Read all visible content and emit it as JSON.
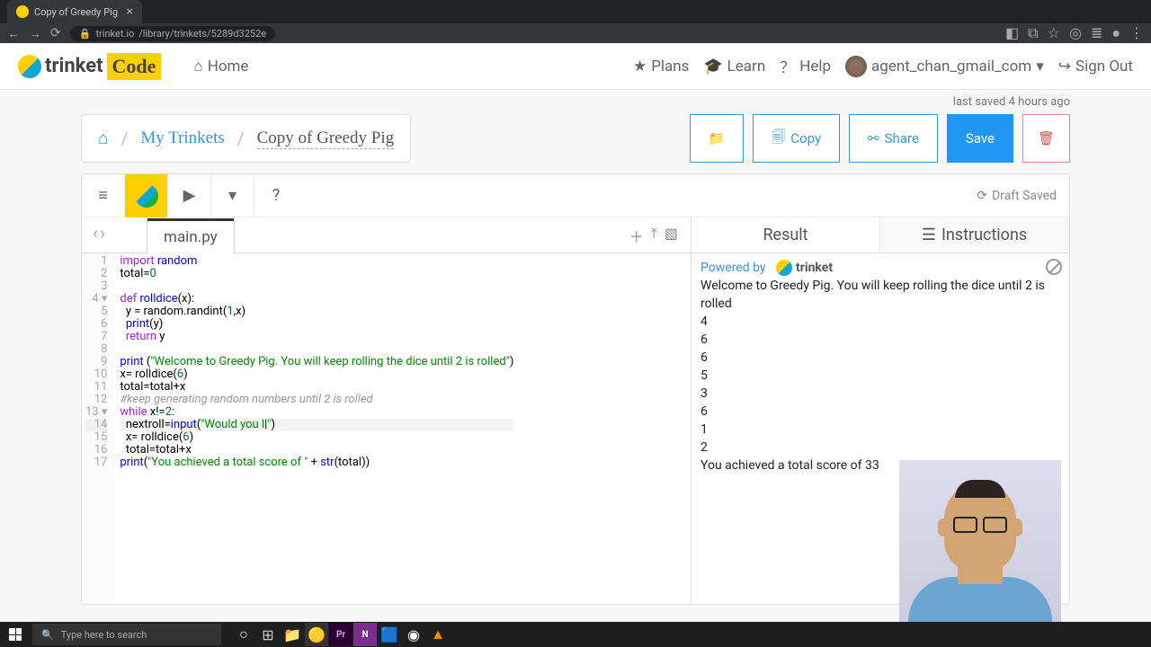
{
  "browser": {
    "tab_title": "Copy of Greedy Pig",
    "url_host": "trinket.io",
    "url_path": "/library/trinkets/5289d3252e"
  },
  "nav": {
    "brand": "trinket",
    "brand_code": "Code",
    "home": "Home",
    "plans": "Plans",
    "learn": "Learn",
    "help": "Help",
    "user": "agent_chan_gmail_com",
    "signout": "Sign Out"
  },
  "status": {
    "saved": "last saved 4 hours ago"
  },
  "breadcrumb": {
    "home_icon": "home",
    "my_trinkets": "My Trinkets",
    "current": "Copy of Greedy Pig"
  },
  "buttons": {
    "copy": "Copy",
    "share": "Share",
    "save": "Save"
  },
  "ide": {
    "draft_saved": "Draft Saved",
    "filename": "main.py",
    "help_icon": "?"
  },
  "code": {
    "lines": [
      {
        "n": 1,
        "text": "import random",
        "tokens": [
          [
            "kw",
            "import"
          ],
          [
            "",
            " "
          ],
          [
            "fn",
            "random"
          ]
        ]
      },
      {
        "n": 2,
        "text": "total=0",
        "tokens": [
          [
            "",
            "total="
          ],
          [
            "num",
            "0"
          ]
        ]
      },
      {
        "n": 3,
        "text": "",
        "tokens": [
          [
            "",
            ""
          ]
        ]
      },
      {
        "n": 4,
        "fold": true,
        "text": "def rolldice(x):",
        "tokens": [
          [
            "kw",
            "def"
          ],
          [
            "",
            " "
          ],
          [
            "fn",
            "rolldice"
          ],
          [
            "",
            "(x):"
          ]
        ]
      },
      {
        "n": 5,
        "text": "  y = random.randint(1,x)",
        "tokens": [
          [
            "",
            "  y = random.randint("
          ],
          [
            "num",
            "1"
          ],
          [
            "",
            ",x)"
          ]
        ]
      },
      {
        "n": 6,
        "text": "  print(y)",
        "tokens": [
          [
            "",
            "  "
          ],
          [
            "fn",
            "print"
          ],
          [
            "",
            "(y)"
          ]
        ]
      },
      {
        "n": 7,
        "text": "  return y",
        "tokens": [
          [
            "",
            "  "
          ],
          [
            "kw",
            "return"
          ],
          [
            "",
            " y"
          ]
        ]
      },
      {
        "n": 8,
        "text": "",
        "tokens": [
          [
            "",
            ""
          ]
        ]
      },
      {
        "n": 9,
        "text": "print (\"Welcome to Greedy Pig. You will keep rolling the dice until 2 is rolled\")",
        "tokens": [
          [
            "fn",
            "print"
          ],
          [
            "",
            " ("
          ],
          [
            "str",
            "\"Welcome to Greedy Pig. You will keep rolling the dice until 2 is rolled\""
          ],
          [
            "",
            ")"
          ]
        ]
      },
      {
        "n": 10,
        "text": "x= rolldice(6)",
        "tokens": [
          [
            "",
            "x= rolldice("
          ],
          [
            "num",
            "6"
          ],
          [
            "",
            ")"
          ]
        ]
      },
      {
        "n": 11,
        "text": "total=total+x",
        "tokens": [
          [
            "",
            "total=total+x"
          ]
        ]
      },
      {
        "n": 12,
        "text": "#keep generating random numbers until 2 is rolled",
        "tokens": [
          [
            "cm",
            "#keep generating random numbers until 2 is rolled"
          ]
        ]
      },
      {
        "n": 13,
        "fold": true,
        "text": "while x!=2:",
        "tokens": [
          [
            "kw",
            "while"
          ],
          [
            "",
            " x!="
          ],
          [
            "num",
            "2"
          ],
          [
            "",
            ":"
          ]
        ]
      },
      {
        "n": 14,
        "hl": true,
        "text": "  nextroll=input(\"Would you l|\")",
        "tokens": [
          [
            "",
            "  nextroll="
          ],
          [
            "fn",
            "input"
          ],
          [
            "",
            "("
          ],
          [
            "str",
            "\"Would you l"
          ],
          [
            "",
            "|"
          ],
          [
            "str",
            "\""
          ],
          [
            "",
            ")"
          ]
        ]
      },
      {
        "n": 15,
        "text": "  x= rolldice(6)",
        "tokens": [
          [
            "",
            "  x= rolldice("
          ],
          [
            "num",
            "6"
          ],
          [
            "",
            ")"
          ]
        ]
      },
      {
        "n": 16,
        "text": "  total=total+x",
        "tokens": [
          [
            "",
            "  total=total+x"
          ]
        ]
      },
      {
        "n": 17,
        "text": "print(\"You achieved a total score of \" + str(total))",
        "tokens": [
          [
            "fn",
            "print"
          ],
          [
            "",
            "("
          ],
          [
            "str",
            "\"You achieved a total score of \""
          ],
          [
            "",
            " + "
          ],
          [
            "fn",
            "str"
          ],
          [
            "",
            "(total))"
          ]
        ]
      }
    ]
  },
  "result": {
    "tab_result": "Result",
    "tab_instructions": "Instructions",
    "powered_by": "Powered by",
    "powered_brand": "trinket",
    "output_lines": [
      "Welcome to Greedy Pig. You will keep rolling the dice until 2 is rolled",
      "4",
      "6",
      "6",
      "5",
      "3",
      "6",
      "1",
      "2",
      "You achieved a total score of 33"
    ]
  },
  "taskbar": {
    "search_placeholder": "Type here to search"
  }
}
